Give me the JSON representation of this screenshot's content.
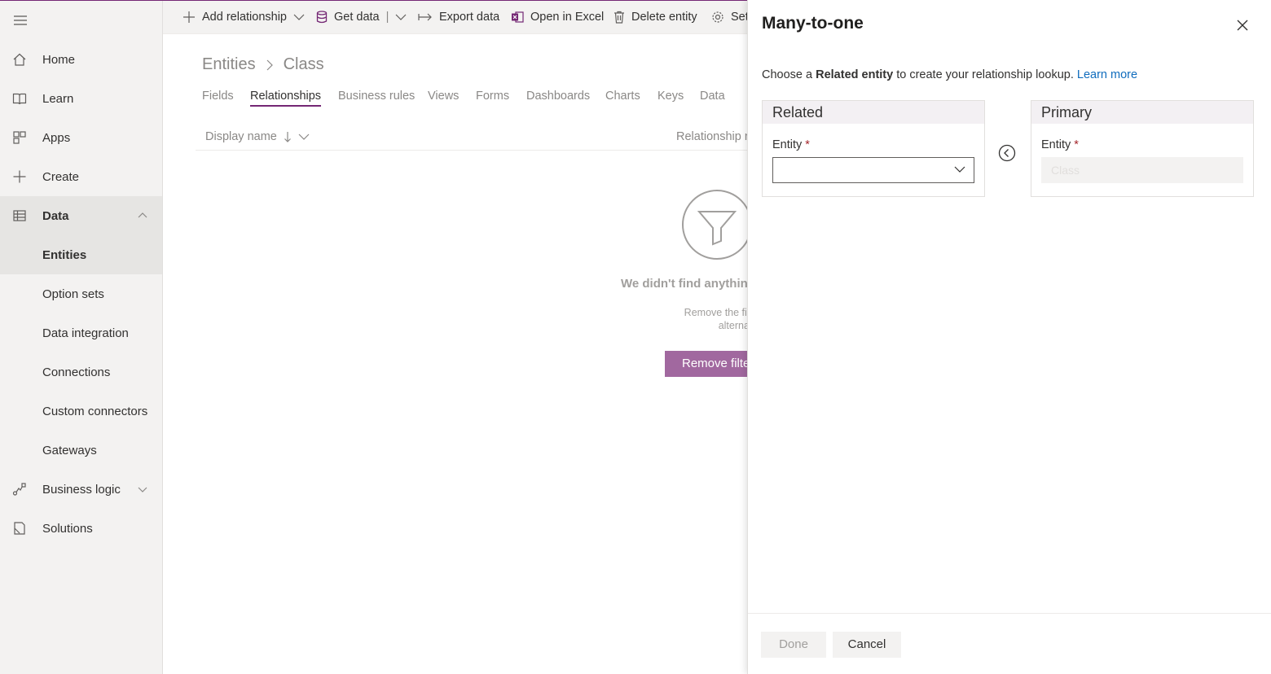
{
  "colors": {
    "accent": "#742774",
    "link": "#0f6cbd",
    "required": "#a4262c"
  },
  "sidebar": {
    "items": [
      {
        "label": "Home",
        "icon": "home-icon"
      },
      {
        "label": "Learn",
        "icon": "book-icon"
      },
      {
        "label": "Apps",
        "icon": "apps-icon"
      },
      {
        "label": "Create",
        "icon": "plus-icon"
      },
      {
        "label": "Data",
        "icon": "table-icon"
      },
      {
        "label": "Entities"
      },
      {
        "label": "Option sets"
      },
      {
        "label": "Data integration"
      },
      {
        "label": "Connections"
      },
      {
        "label": "Custom connectors"
      },
      {
        "label": "Gateways"
      },
      {
        "label": "Business logic",
        "icon": "flow-icon"
      },
      {
        "label": "Solutions",
        "icon": "solutions-icon"
      }
    ]
  },
  "commandbar": {
    "add_relationship": "Add relationship",
    "get_data": "Get data",
    "export_data": "Export data",
    "open_in_excel": "Open in Excel",
    "delete_entity": "Delete entity",
    "settings": "Set"
  },
  "breadcrumb": {
    "root": "Entities",
    "current": "Class"
  },
  "tabs": [
    "Fields",
    "Relationships",
    "Business rules",
    "Views",
    "Forms",
    "Dashboards",
    "Charts",
    "Keys",
    "Data"
  ],
  "list": {
    "col_display": "Display name",
    "col_relationship": "Relationship n"
  },
  "empty": {
    "title": "We didn't find anything",
    "desc_line1": "Remove the filter to see other ite",
    "desc_line2": "alternate search t",
    "button": "Remove filte"
  },
  "panel": {
    "title": "Many-to-one",
    "desc_pre": "Choose a ",
    "desc_bold": "Related entity",
    "desc_post": " to create your relationship lookup. ",
    "desc_link": "Learn more",
    "related": {
      "header": "Related",
      "field_label": "Entity",
      "required": "*",
      "value": ""
    },
    "primary": {
      "header": "Primary",
      "field_label": "Entity",
      "required": "*",
      "value": "Class"
    },
    "done": "Done",
    "cancel": "Cancel"
  }
}
